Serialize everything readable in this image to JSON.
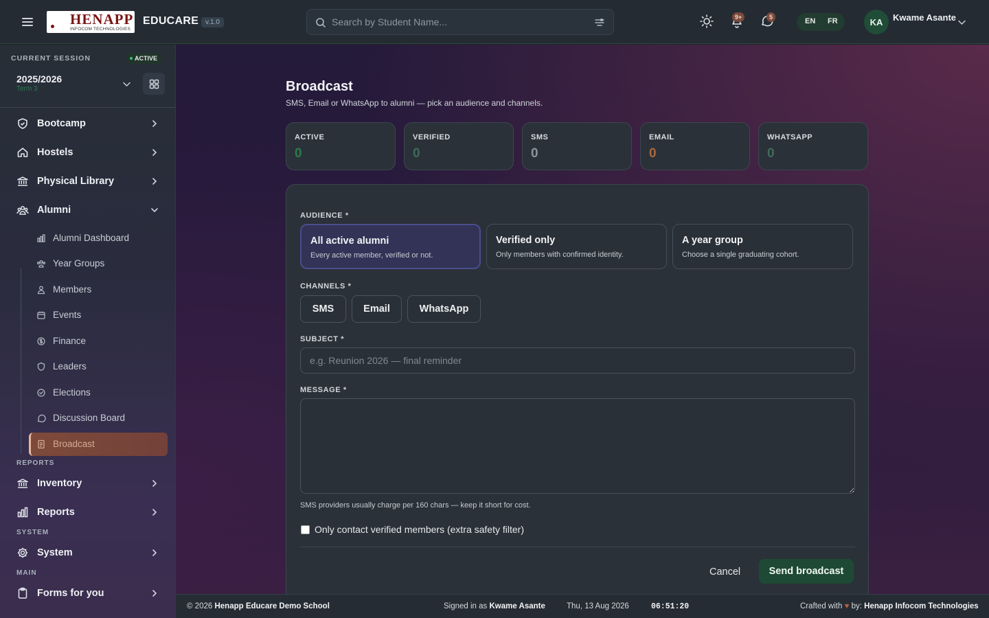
{
  "header": {
    "logo_text": "HENAPP",
    "logo_subtext": "INFOCOM TECHNOLOGIES",
    "brand": "EDUCARE",
    "version": "v.1.0",
    "search_placeholder": "Search by Student Name...",
    "notifications_badge": "9+",
    "messages_badge": "5",
    "lang_en": "EN",
    "lang_fr": "FR",
    "user_initials": "KA",
    "user_name": "Kwame Asante"
  },
  "sidebar": {
    "session_label": "CURRENT SESSION",
    "session_status": "ACTIVE",
    "session_year": "2025/2026",
    "session_term": "Term 3",
    "items": [
      {
        "label": "Bootcamp",
        "icon": "shield-icon"
      },
      {
        "label": "Hostels",
        "icon": "home-icon"
      },
      {
        "label": "Physical Library",
        "icon": "library-icon"
      },
      {
        "label": "Alumni",
        "icon": "users-icon"
      }
    ],
    "alumni_sub": [
      {
        "label": "Alumni Dashboard",
        "icon": "chart-icon"
      },
      {
        "label": "Year Groups",
        "icon": "group-icon"
      },
      {
        "label": "Members",
        "icon": "user-icon"
      },
      {
        "label": "Events",
        "icon": "calendar-icon"
      },
      {
        "label": "Finance",
        "icon": "coin-icon"
      },
      {
        "label": "Leaders",
        "icon": "shield-icon"
      },
      {
        "label": "Elections",
        "icon": "check-circle-icon"
      },
      {
        "label": "Discussion Board",
        "icon": "chat-icon"
      },
      {
        "label": "Broadcast",
        "icon": "broadcast-icon"
      }
    ],
    "section_reports": "REPORTS",
    "inventory": "Inventory",
    "reports": "Reports",
    "section_system": "SYSTEM",
    "system": "System",
    "section_main": "MAIN",
    "forms": "Forms for you"
  },
  "page": {
    "title": "Broadcast",
    "subtitle": "SMS, Email or WhatsApp to alumni — pick an audience and channels."
  },
  "stats": [
    {
      "label": "ACTIVE",
      "value": "0",
      "color": "#2e7a4f"
    },
    {
      "label": "VERIFIED",
      "value": "0",
      "color": "#3f6a5c"
    },
    {
      "label": "SMS",
      "value": "0",
      "color": "#8a95a0"
    },
    {
      "label": "EMAIL",
      "value": "0",
      "color": "#a8683c"
    },
    {
      "label": "WHATSAPP",
      "value": "0",
      "color": "#3f6a5c"
    }
  ],
  "form": {
    "audience_label": "AUDIENCE *",
    "audiences": [
      {
        "title": "All active alumni",
        "desc": "Every active member, verified or not."
      },
      {
        "title": "Verified only",
        "desc": "Only members with confirmed identity."
      },
      {
        "title": "A year group",
        "desc": "Choose a single graduating cohort."
      }
    ],
    "channels_label": "CHANNELS *",
    "channels": [
      "SMS",
      "Email",
      "WhatsApp"
    ],
    "subject_label": "SUBJECT *",
    "subject_placeholder": "e.g. Reunion 2026 — final reminder",
    "message_label": "MESSAGE *",
    "hint": "SMS providers usually charge per 160 chars — keep it short for cost.",
    "verified_only_label": "Only contact verified members (extra safety filter)",
    "cancel": "Cancel",
    "send": "Send broadcast"
  },
  "footer": {
    "copyright": "© 2026",
    "school": "Henapp Educare Demo School",
    "signed_in_prefix": "Signed in as",
    "signed_in_user": "Kwame Asante",
    "date": "Thu, 13 Aug 2026",
    "time": "06:51:20",
    "crafted_prefix": "Crafted with",
    "crafted_mid": "by:",
    "crafted_by": "Henapp Infocom Technologies"
  }
}
